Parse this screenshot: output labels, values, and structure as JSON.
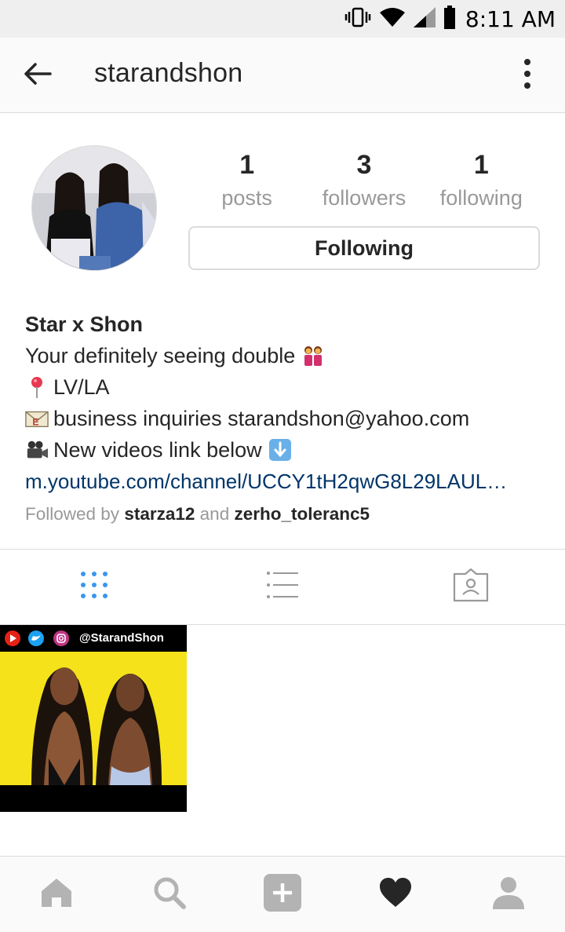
{
  "status_bar": {
    "time": "8:11 AM",
    "icons": [
      "vibrate-icon",
      "wifi-icon",
      "signal-icon",
      "battery-icon"
    ]
  },
  "header": {
    "username": "starandshon",
    "icons": [
      "back-arrow-icon",
      "more-vertical-icon"
    ]
  },
  "stats": {
    "posts": {
      "count": "1",
      "label": "posts"
    },
    "followers": {
      "count": "3",
      "label": "followers"
    },
    "following": {
      "count": "1",
      "label": "following"
    }
  },
  "follow_button": {
    "label": "Following"
  },
  "bio": {
    "name": "Star x Shon",
    "line1": "Your definitely seeing double",
    "line2": "LV/LA",
    "line3": "business inquiries starandshon@yahoo.com",
    "line4": "New videos link below",
    "link": "m.youtube.com/channel/UCCY1tH2qwG8L29LAUL…",
    "followed_by_prefix": "Followed by",
    "followed_by_user1": "starza12",
    "followed_by_and": "and",
    "followed_by_user2": "zerho_toleranc5",
    "emoji_icons": [
      "twins-emoji-icon",
      "pin-emoji-icon",
      "envelope-emoji-icon",
      "movie-camera-emoji-icon",
      "down-arrow-emoji-icon"
    ]
  },
  "tabs": [
    "grid-view-icon",
    "list-view-icon",
    "tagged-photos-icon"
  ],
  "posts": [
    {
      "caption": "@StarandShon"
    }
  ],
  "bottom_nav": [
    "home-icon",
    "search-icon",
    "add-post-icon",
    "activity-heart-icon",
    "profile-icon"
  ],
  "colors": {
    "link": "#003569",
    "active_tab": "#3897f0",
    "muted": "#999999",
    "text": "#262626",
    "border": "#dbdbdb",
    "thumb_yellow": "#f5e21a"
  }
}
